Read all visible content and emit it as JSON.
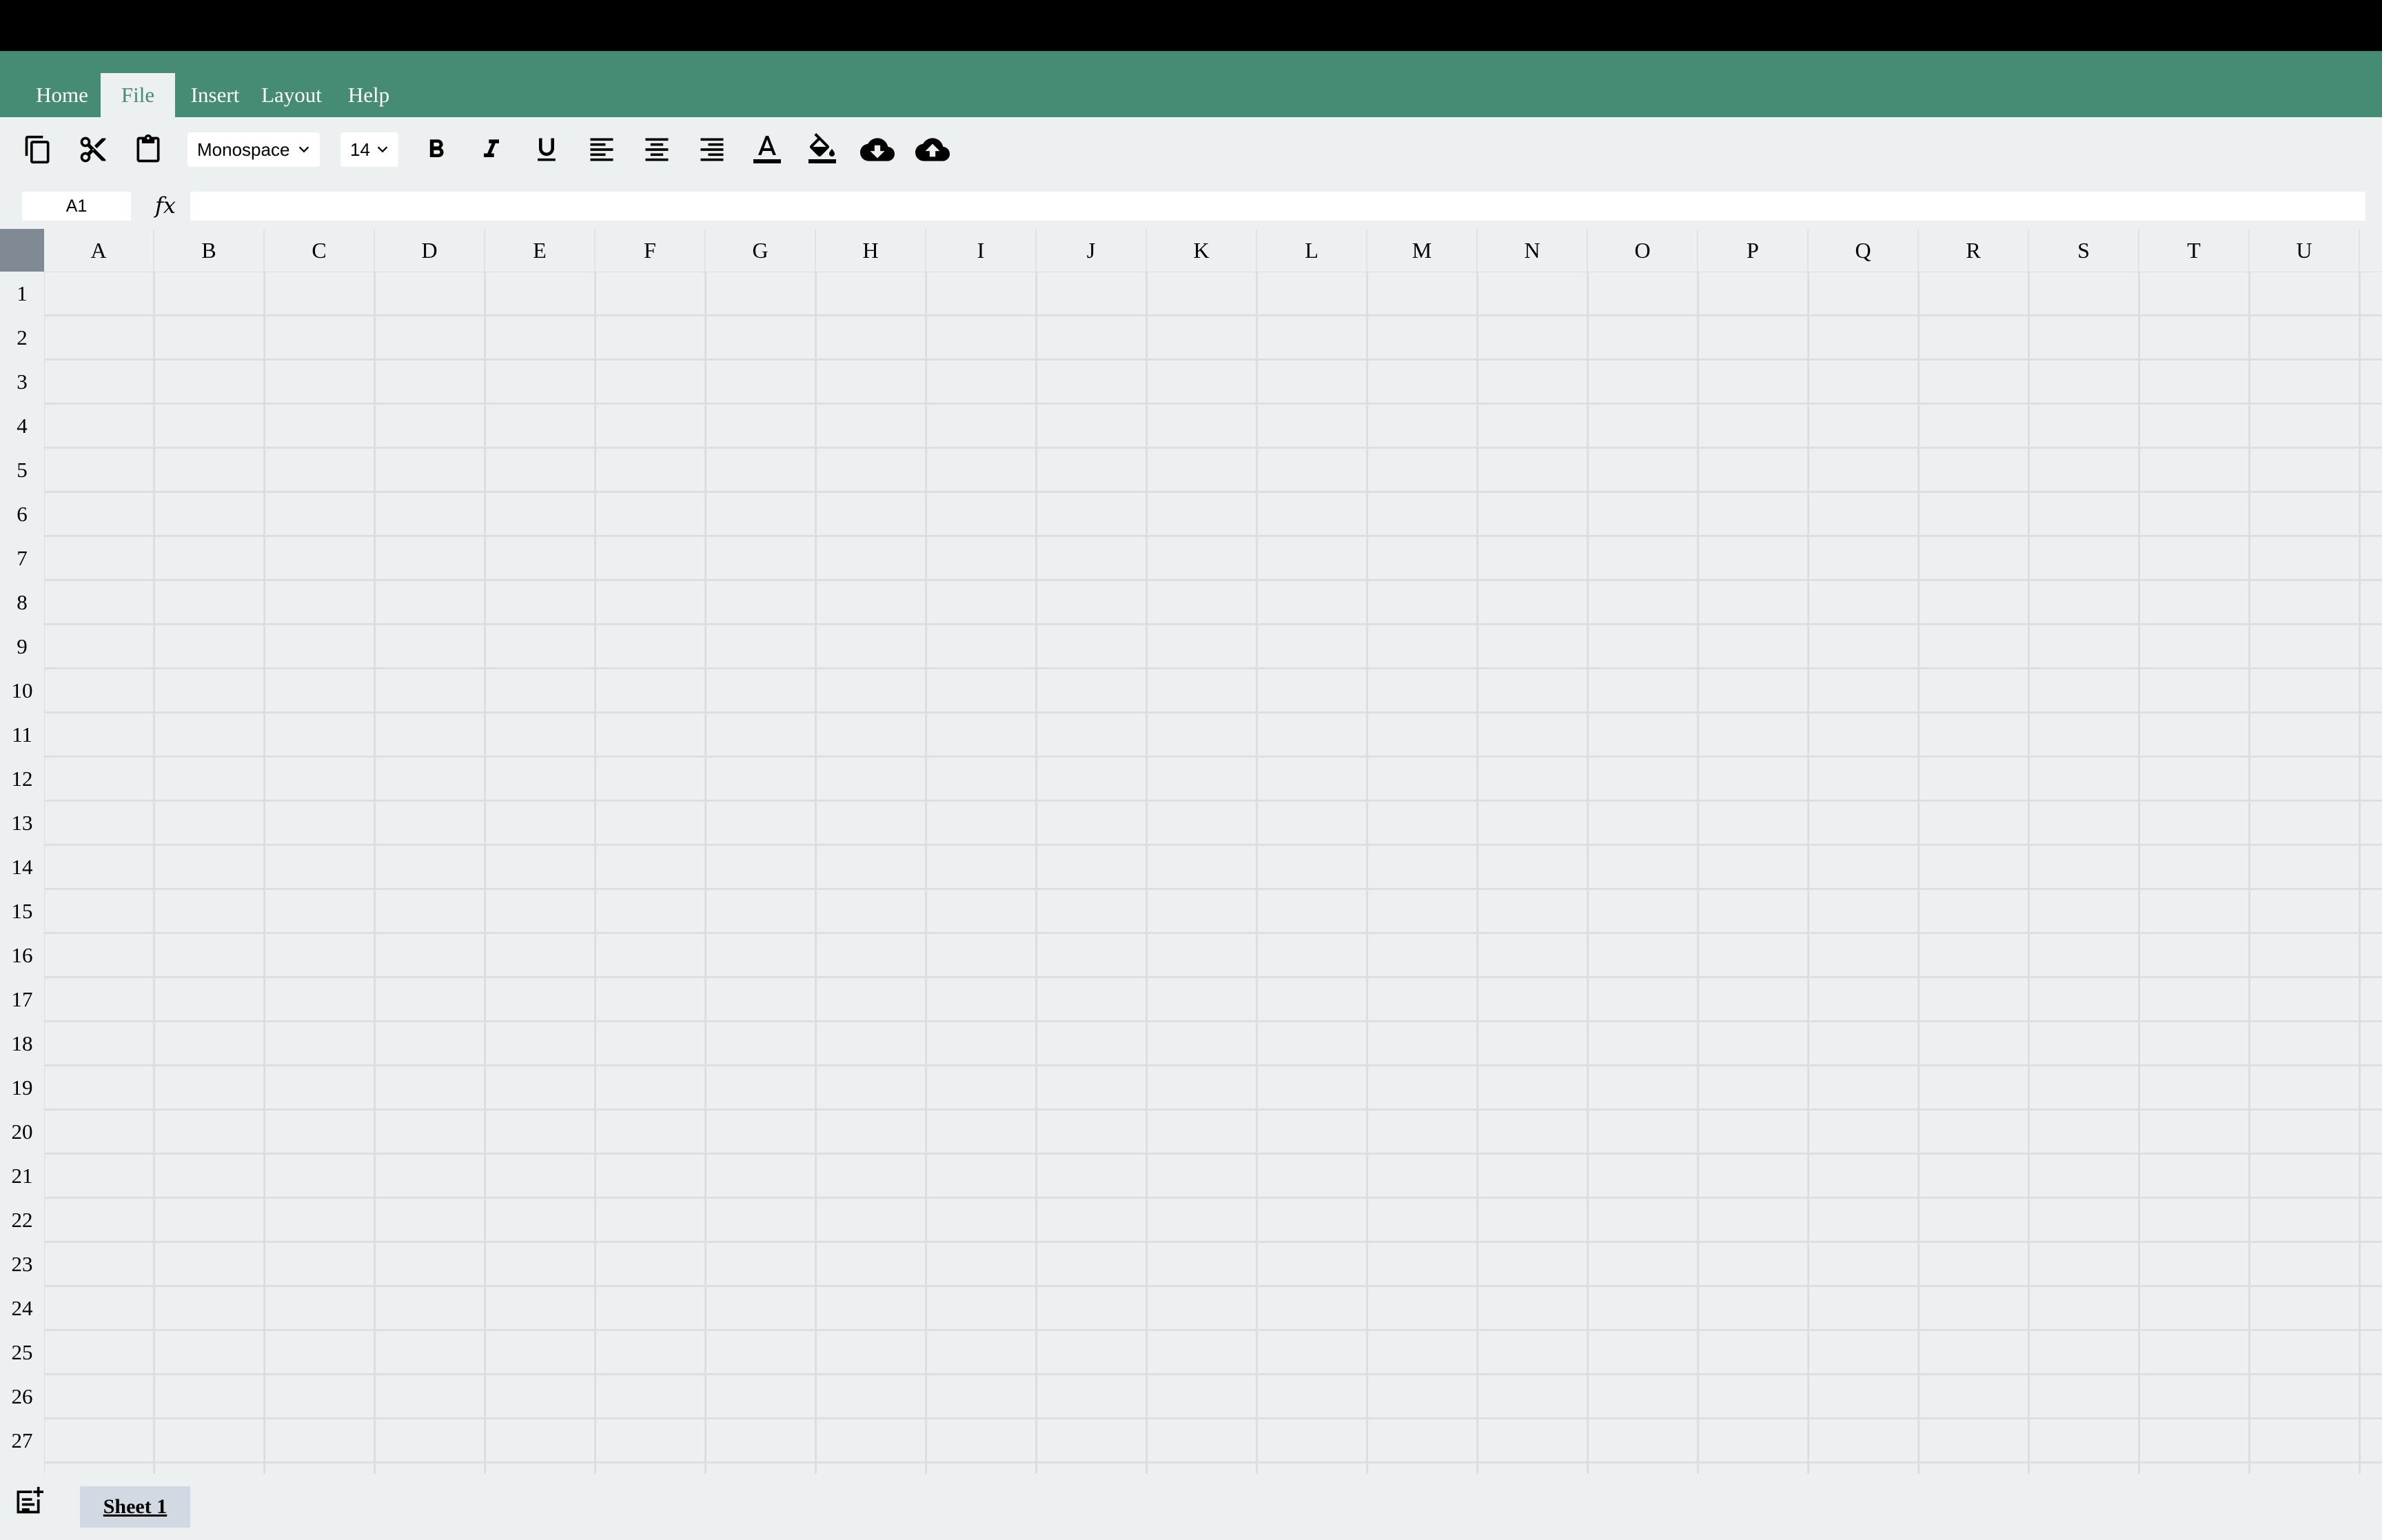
{
  "menu": {
    "items": [
      {
        "label": "Home"
      },
      {
        "label": "File",
        "active": true
      },
      {
        "label": "Insert"
      },
      {
        "label": "Layout"
      },
      {
        "label": "Help"
      }
    ]
  },
  "toolbar": {
    "font_family": "Monospace",
    "font_size": "14",
    "icons": [
      "copy-icon",
      "cut-icon",
      "paste-icon",
      "bold-icon",
      "italic-icon",
      "underline-icon",
      "align-left-icon",
      "align-center-icon",
      "align-right-icon",
      "text-color-icon",
      "fill-color-icon",
      "cloud-download-icon",
      "cloud-upload-icon"
    ]
  },
  "formula_bar": {
    "cell_ref": "A1",
    "fx_label": "fx",
    "formula": ""
  },
  "grid": {
    "columns": [
      "A",
      "B",
      "C",
      "D",
      "E",
      "F",
      "G",
      "H",
      "I",
      "J",
      "K",
      "L",
      "M",
      "N",
      "O",
      "P",
      "Q",
      "R",
      "S",
      "T",
      "U"
    ],
    "rows": [
      "1",
      "2",
      "3",
      "4",
      "5",
      "6",
      "7",
      "8",
      "9",
      "10",
      "11",
      "12",
      "13",
      "14",
      "15",
      "16",
      "17",
      "18",
      "19",
      "20",
      "21",
      "22",
      "23",
      "24",
      "25",
      "26",
      "27"
    ]
  },
  "sheets": {
    "tabs": [
      {
        "label": "Sheet 1",
        "active": true
      }
    ],
    "add_icon": "add-sheet-icon"
  },
  "colors": {
    "menu_bar": "#468b74",
    "background": "#ecf0f0",
    "corner": "#7f8a94",
    "sheet_tab": "#d2d9e3"
  }
}
